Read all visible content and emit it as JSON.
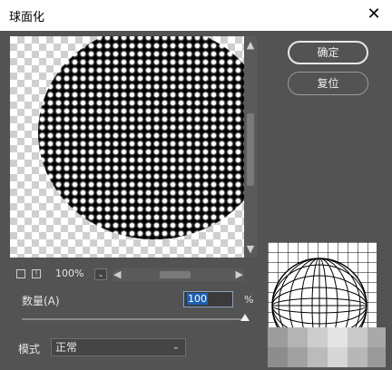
{
  "window": {
    "title": "球面化",
    "close_icon": "close-icon"
  },
  "preview": {
    "zoom_label": "100%",
    "zoom_dropdown_icon": "chevron-down-icon"
  },
  "buttons": {
    "ok_label": "确定",
    "reset_label": "复位"
  },
  "amount": {
    "label": "数量(A)",
    "value": "100",
    "unit": "%"
  },
  "mode": {
    "label": "模式",
    "selected": "正常"
  },
  "colors": {
    "background": "#535353",
    "titlebar": "#ffffff",
    "input_highlight": "#1e5fb3"
  }
}
